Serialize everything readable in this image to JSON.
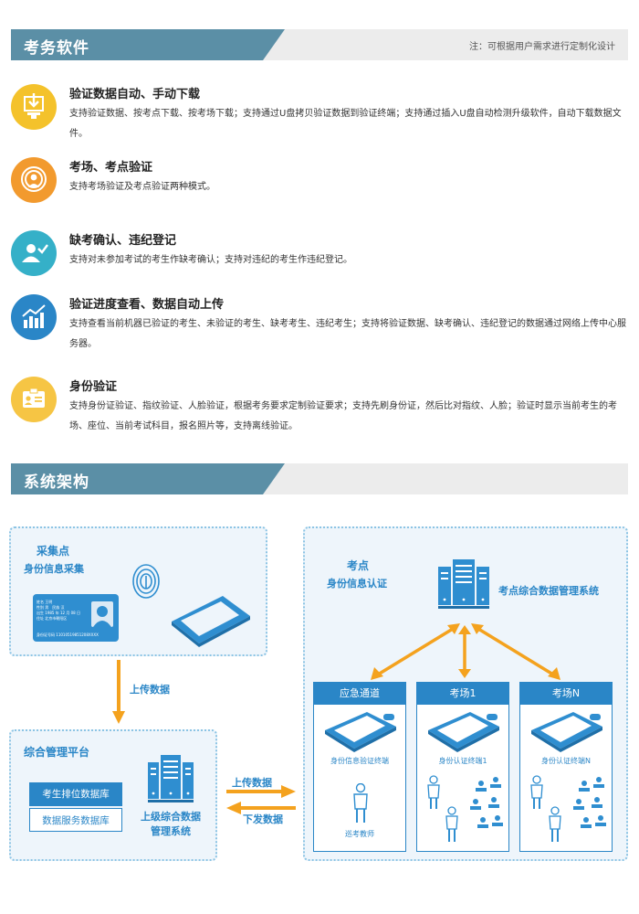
{
  "section1": {
    "title": "考务软件",
    "note": "注：可根据用户需求进行定制化设计"
  },
  "features": [
    {
      "title": "验证数据自动、手动下载",
      "desc": "支持验证数据、按考点下载、按考场下载；支持通过U盘拷贝验证数据到验证终端；支持通过插入U盘自动检测升级软件，自动下载数据文件。",
      "icon": "download-icon",
      "color": "#f4c22b"
    },
    {
      "title": "考场、考点验证",
      "desc": "支持考场验证及考点验证两种模式。",
      "icon": "signal-person-icon",
      "color": "#f29a2e"
    },
    {
      "title": "缺考确认、违纪登记",
      "desc": "支持对未参加考试的考生作缺考确认；支持对违纪的考生作违纪登记。",
      "icon": "user-check-icon",
      "color": "#35b0c8"
    },
    {
      "title": "验证进度查看、数据自动上传",
      "desc": "支持查看当前机器已验证的考生、未验证的考生、缺考考生、违纪考生；支持将验证数据、缺考确认、违纪登记的数据通过网络上传中心服务器。",
      "icon": "chart-icon",
      "color": "#2a86c7"
    },
    {
      "title": "身份验证",
      "desc": "支持身份证验证、指纹验证、人脸验证，根据考务要求定制验证要求；支持先刷身份证，然后比对指纹、人脸；验证时显示当前考生的考场、座位、当前考试科目，报名照片等，支持离线验证。",
      "icon": "id-card-icon",
      "color": "#f6c544"
    }
  ],
  "section2": {
    "title": "系统架构"
  },
  "diagram": {
    "collect": {
      "title": "采集点",
      "subtitle": "身份信息采集",
      "card_name": "姓名 王明",
      "card_gender": "性别 男　民族 汉",
      "card_birth": "出生 1985 年 12 月 08 日",
      "card_addr": "住址 北京市朝阳区",
      "card_id": "身份证号码 11010519851208XXXX"
    },
    "upload_label": "上传数据",
    "platform": {
      "title": "综合管理平台",
      "db1": "考生排位数据库",
      "db2": "数据服务数据库",
      "server_label_1": "上级综合数据",
      "server_label_2": "管理系统"
    },
    "arrows": {
      "upload": "上传数据",
      "download": "下发数据"
    },
    "site": {
      "title": "考点",
      "subtitle": "身份信息认证",
      "server_label": "考点综合数据管理系统",
      "sub_panels": [
        {
          "head": "应急通道",
          "terminal": "身份信息验证终端",
          "person": "巡考教师"
        },
        {
          "head": "考场1",
          "terminal": "身份认证终端1"
        },
        {
          "head": "考场N",
          "terminal": "身份认证终端N"
        }
      ]
    }
  }
}
